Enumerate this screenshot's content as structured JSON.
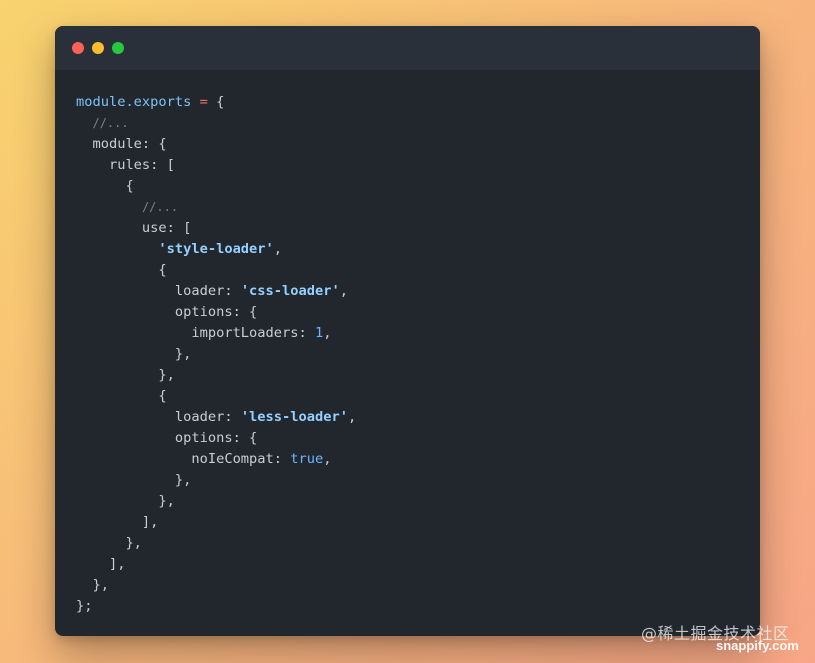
{
  "window": {
    "controls": [
      "close",
      "minimize",
      "zoom"
    ],
    "colors": {
      "close": "#fe5f57",
      "minimize": "#febc2e",
      "zoom": "#28c840"
    }
  },
  "code_lines": [
    [
      {
        "t": "blue",
        "v": "module.exports"
      },
      {
        "t": "plain",
        "v": " "
      },
      {
        "t": "op",
        "v": "="
      },
      {
        "t": "plain",
        "v": " {"
      }
    ],
    [
      {
        "t": "plain",
        "v": "  "
      },
      {
        "t": "comment",
        "v": "//..."
      }
    ],
    [
      {
        "t": "plain",
        "v": "  module: {"
      }
    ],
    [
      {
        "t": "plain",
        "v": "    rules: ["
      }
    ],
    [
      {
        "t": "plain",
        "v": "      {"
      }
    ],
    [
      {
        "t": "plain",
        "v": "        "
      },
      {
        "t": "comment",
        "v": "//..."
      }
    ],
    [
      {
        "t": "plain",
        "v": "        use: ["
      }
    ],
    [
      {
        "t": "plain",
        "v": "          "
      },
      {
        "t": "str",
        "v": "'style-loader'"
      },
      {
        "t": "plain",
        "v": ","
      }
    ],
    [
      {
        "t": "plain",
        "v": "          {"
      }
    ],
    [
      {
        "t": "plain",
        "v": "            loader: "
      },
      {
        "t": "str",
        "v": "'css-loader'"
      },
      {
        "t": "plain",
        "v": ","
      }
    ],
    [
      {
        "t": "plain",
        "v": "            options: {"
      }
    ],
    [
      {
        "t": "plain",
        "v": "              importLoaders: "
      },
      {
        "t": "num",
        "v": "1"
      },
      {
        "t": "plain",
        "v": ","
      }
    ],
    [
      {
        "t": "plain",
        "v": "            },"
      }
    ],
    [
      {
        "t": "plain",
        "v": "          },"
      }
    ],
    [
      {
        "t": "plain",
        "v": "          {"
      }
    ],
    [
      {
        "t": "plain",
        "v": "            loader: "
      },
      {
        "t": "str",
        "v": "'less-loader'"
      },
      {
        "t": "plain",
        "v": ","
      }
    ],
    [
      {
        "t": "plain",
        "v": "            options: {"
      }
    ],
    [
      {
        "t": "plain",
        "v": "              noIeCompat: "
      },
      {
        "t": "num",
        "v": "true"
      },
      {
        "t": "plain",
        "v": ","
      }
    ],
    [
      {
        "t": "plain",
        "v": "            },"
      }
    ],
    [
      {
        "t": "plain",
        "v": "          },"
      }
    ],
    [
      {
        "t": "plain",
        "v": "        ],"
      }
    ],
    [
      {
        "t": "plain",
        "v": "      },"
      }
    ],
    [
      {
        "t": "plain",
        "v": "    ],"
      }
    ],
    [
      {
        "t": "plain",
        "v": "  },"
      }
    ],
    [
      {
        "t": "plain",
        "v": "};"
      }
    ]
  ],
  "watermark": {
    "site": "@稀土掘金技术社区",
    "brand": "snappify.com"
  }
}
